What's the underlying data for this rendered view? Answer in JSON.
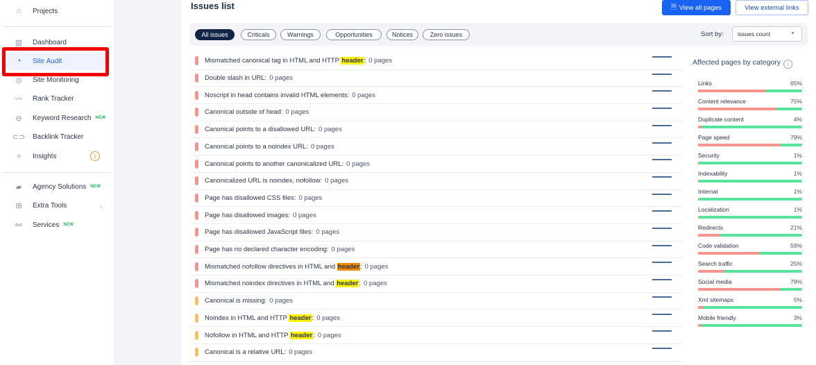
{
  "sidebar": {
    "items": [
      {
        "label": "Projects",
        "icon": "home-icon"
      },
      {
        "label": "Dashboard",
        "icon": "dashboard-icon"
      },
      {
        "label": "Site Audit",
        "icon": "gauge-icon",
        "active": true
      },
      {
        "label": "Site Monitoring",
        "icon": "monitoring-icon"
      },
      {
        "label": "Rank Tracker",
        "icon": "trend-icon"
      },
      {
        "label": "Keyword Research",
        "icon": "keyword-icon",
        "badge": "NEW"
      },
      {
        "label": "Backlink Tracker",
        "icon": "link-icon"
      },
      {
        "label": "Insights",
        "icon": "magic-wand-icon"
      },
      {
        "label": "Agency Solutions",
        "icon": "briefcase-icon",
        "badge": "NEW"
      },
      {
        "label": "Extra Tools",
        "icon": "grid-plus-icon"
      },
      {
        "label": "Services",
        "icon": "services-icon",
        "badge": "NEW"
      }
    ]
  },
  "header": {
    "title": "Issues list",
    "view_all_pages": "View all pages",
    "view_external_links": "View external links"
  },
  "filters": {
    "chips": [
      "All issues",
      "Criticals",
      "Warnings",
      "Opportunities",
      "Notices",
      "Zero issues"
    ],
    "active": "All issues",
    "sort_label": "Sort by:",
    "sort_value": "issues count"
  },
  "colors": {
    "critical": "#f5958e",
    "warning": "#fbbf6a",
    "accent": "#1a63f2",
    "bar_ok": "#57e39c",
    "bar_bad": "#f5958e"
  },
  "issues": [
    {
      "pre": "Mismatched canonical tag in HTML and HTTP ",
      "hl": "header",
      "post": ":",
      "count": "0 pages",
      "severity": "critical"
    },
    {
      "pre": "Double slash in URL:",
      "hl": "",
      "post": "",
      "count": "0 pages",
      "severity": "critical"
    },
    {
      "pre": "Noscript in head contains invalid HTML elements:",
      "hl": "",
      "post": "",
      "count": "0 pages",
      "severity": "critical"
    },
    {
      "pre": "Canonical outside of head:",
      "hl": "",
      "post": "",
      "count": "0 pages",
      "severity": "critical"
    },
    {
      "pre": "Canonical points to a disallowed URL:",
      "hl": "",
      "post": "",
      "count": "0 pages",
      "severity": "critical"
    },
    {
      "pre": "Canonical points to a noindex URL:",
      "hl": "",
      "post": "",
      "count": "0 pages",
      "severity": "critical"
    },
    {
      "pre": "Canonical points to another canonicalized URL:",
      "hl": "",
      "post": "",
      "count": "0 pages",
      "severity": "critical"
    },
    {
      "pre": "Canonicalized URL is noindex, nofollow:",
      "hl": "",
      "post": "",
      "count": "0 pages",
      "severity": "critical"
    },
    {
      "pre": "Page has disallowed CSS files:",
      "hl": "",
      "post": "",
      "count": "0 pages",
      "severity": "critical"
    },
    {
      "pre": "Page has disallowed images:",
      "hl": "",
      "post": "",
      "count": "0 pages",
      "severity": "critical"
    },
    {
      "pre": "Page has disallowed JavaScript files:",
      "hl": "",
      "post": "",
      "count": "0 pages",
      "severity": "critical"
    },
    {
      "pre": "Page has no declared character encoding:",
      "hl": "",
      "post": "",
      "count": "0 pages",
      "severity": "critical"
    },
    {
      "pre": "Mismatched nofollow directives in HTML and ",
      "hl": "header",
      "post": ":",
      "count": "0 pages",
      "severity": "critical",
      "hl_orange": true
    },
    {
      "pre": "Mismatched noindex directives in HTML and ",
      "hl": "header",
      "post": ":",
      "count": "0 pages",
      "severity": "critical"
    },
    {
      "pre": "Canonical is missing:",
      "hl": "",
      "post": "",
      "count": "0 pages",
      "severity": "warning"
    },
    {
      "pre": "Noindex in HTML and HTTP ",
      "hl": "header",
      "post": ":",
      "count": "0 pages",
      "severity": "warning"
    },
    {
      "pre": "Nofollow in HTML and HTTP ",
      "hl": "header",
      "post": ":",
      "count": "0 pages",
      "severity": "warning"
    },
    {
      "pre": "Canonical is a relative URL:",
      "hl": "",
      "post": "",
      "count": "0 pages",
      "severity": "warning"
    }
  ],
  "categories": {
    "title": "Affected pages by category",
    "items": [
      {
        "label": "Links",
        "pct": "65%",
        "value": 65
      },
      {
        "label": "Content relevance",
        "pct": "75%",
        "value": 75
      },
      {
        "label": "Duplicate content",
        "pct": "4%",
        "value": 4
      },
      {
        "label": "Page speed",
        "pct": "79%",
        "value": 79
      },
      {
        "label": "Security",
        "pct": "1%",
        "value": 1
      },
      {
        "label": "Indexability",
        "pct": "1%",
        "value": 1
      },
      {
        "label": "Internal",
        "pct": "1%",
        "value": 1
      },
      {
        "label": "Localization",
        "pct": "1%",
        "value": 1
      },
      {
        "label": "Redirects",
        "pct": "21%",
        "value": 21
      },
      {
        "label": "Code validation",
        "pct": "59%",
        "value": 59
      },
      {
        "label": "Search traffic",
        "pct": "25%",
        "value": 25
      },
      {
        "label": "Social media",
        "pct": "79%",
        "value": 79
      },
      {
        "label": "Xml sitemaps",
        "pct": "5%",
        "value": 5
      },
      {
        "label": "Mobile friendly",
        "pct": "3%",
        "value": 3
      }
    ]
  }
}
